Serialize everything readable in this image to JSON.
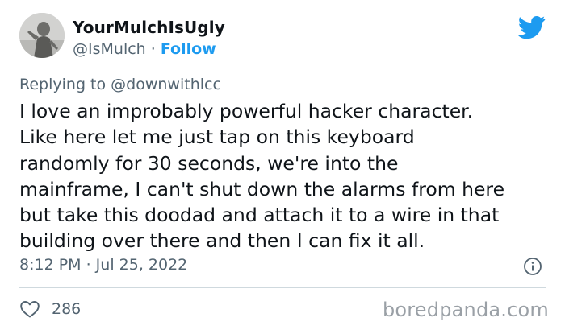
{
  "author": {
    "display_name": "YourMulchIsUgly",
    "handle": "@IsMulch",
    "separator": " · ",
    "follow_label": "Follow"
  },
  "reply": {
    "prefix": "Replying to ",
    "mention": "@downwithlcc"
  },
  "tweet": {
    "lines": [
      "I love an improbably powerful hacker character.",
      "Like here let me just tap on this keyboard",
      "randomly for 30 seconds, we're into the",
      "mainframe, I can't shut down the alarms from here",
      "but take this doodad and attach it to a wire in that",
      "building over there and then I can fix it all."
    ],
    "timestamp": "8:12 PM · Jul 25, 2022"
  },
  "engagement": {
    "like_count": "286"
  },
  "watermark": "boredpanda.com",
  "icons": {
    "platform": "twitter-bird-icon",
    "info": "info-icon",
    "like": "heart-icon"
  },
  "colors": {
    "brand_blue": "#1d9bf0",
    "text": "#0f1419",
    "secondary_text": "#536471",
    "divider": "#cfd9de",
    "watermark": "#9aa0a6"
  }
}
